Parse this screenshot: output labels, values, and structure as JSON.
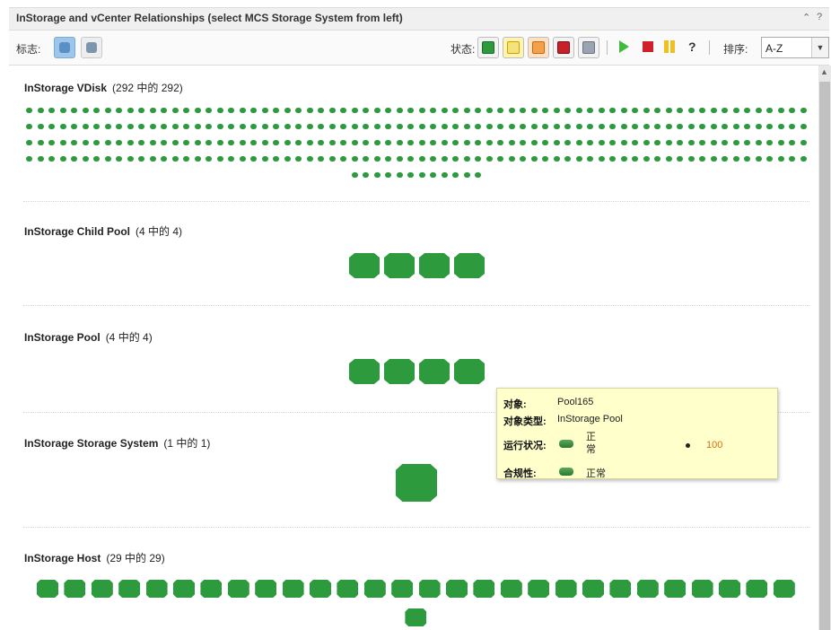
{
  "window": {
    "title": "InStorage and vCenter Relationships (select MCS Storage System from left)",
    "collapse_icon": "collapse-icon",
    "help_label": "?"
  },
  "toolbar": {
    "mark_label": "标志:",
    "status_label": "状态:",
    "help_label": "?",
    "sort_label": "排序:",
    "sort_value": "A-Z",
    "status_colors": {
      "normal": "#2e9a3e",
      "warning": "#f0c020",
      "minor": "#f08a20",
      "critical": "#c8202a",
      "unknown": "#9aa4b0"
    }
  },
  "sections": [
    {
      "title": "InStorage VDisk",
      "count": "(292 中的 292)"
    },
    {
      "title": "InStorage Child Pool",
      "count": "(4 中的 4)"
    },
    {
      "title": "InStorage Pool",
      "count": "(4 中的 4)"
    },
    {
      "title": "InStorage Storage System",
      "count": "(1 中的 1)"
    },
    {
      "title": "InStorage Host",
      "count": "(29 中的 29)"
    }
  ],
  "tooltip": {
    "object_label": "对象:",
    "object_value": "Pool165",
    "type_label": "对象类型:",
    "type_value": "InStorage Pool",
    "health_label": "运行状况:",
    "health_value": "正常",
    "health_score": "100",
    "compliance_label": "合规性:",
    "compliance_value": "正常"
  }
}
